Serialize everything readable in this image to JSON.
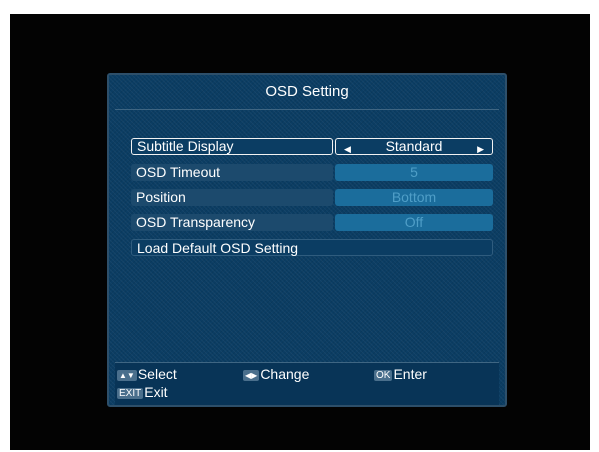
{
  "menu": {
    "title": "OSD Setting",
    "items": [
      {
        "label": "Subtitle Display",
        "value": "Standard"
      },
      {
        "label": "OSD Timeout",
        "value": "5"
      },
      {
        "label": "Position",
        "value": "Bottom"
      },
      {
        "label": "OSD Transparency",
        "value": "Off"
      }
    ],
    "load_default_label": "Load Default OSD Setting"
  },
  "footer": {
    "select_label": "Select",
    "change_label": "Change",
    "ok_key": "OK",
    "enter_label": "Enter",
    "exit_key": "EXIT",
    "exit_label": "Exit"
  },
  "colors": {
    "panel": "#0b3d63",
    "value_fill": "#1b6d9c",
    "highlight_border": "#f2f2f2"
  }
}
